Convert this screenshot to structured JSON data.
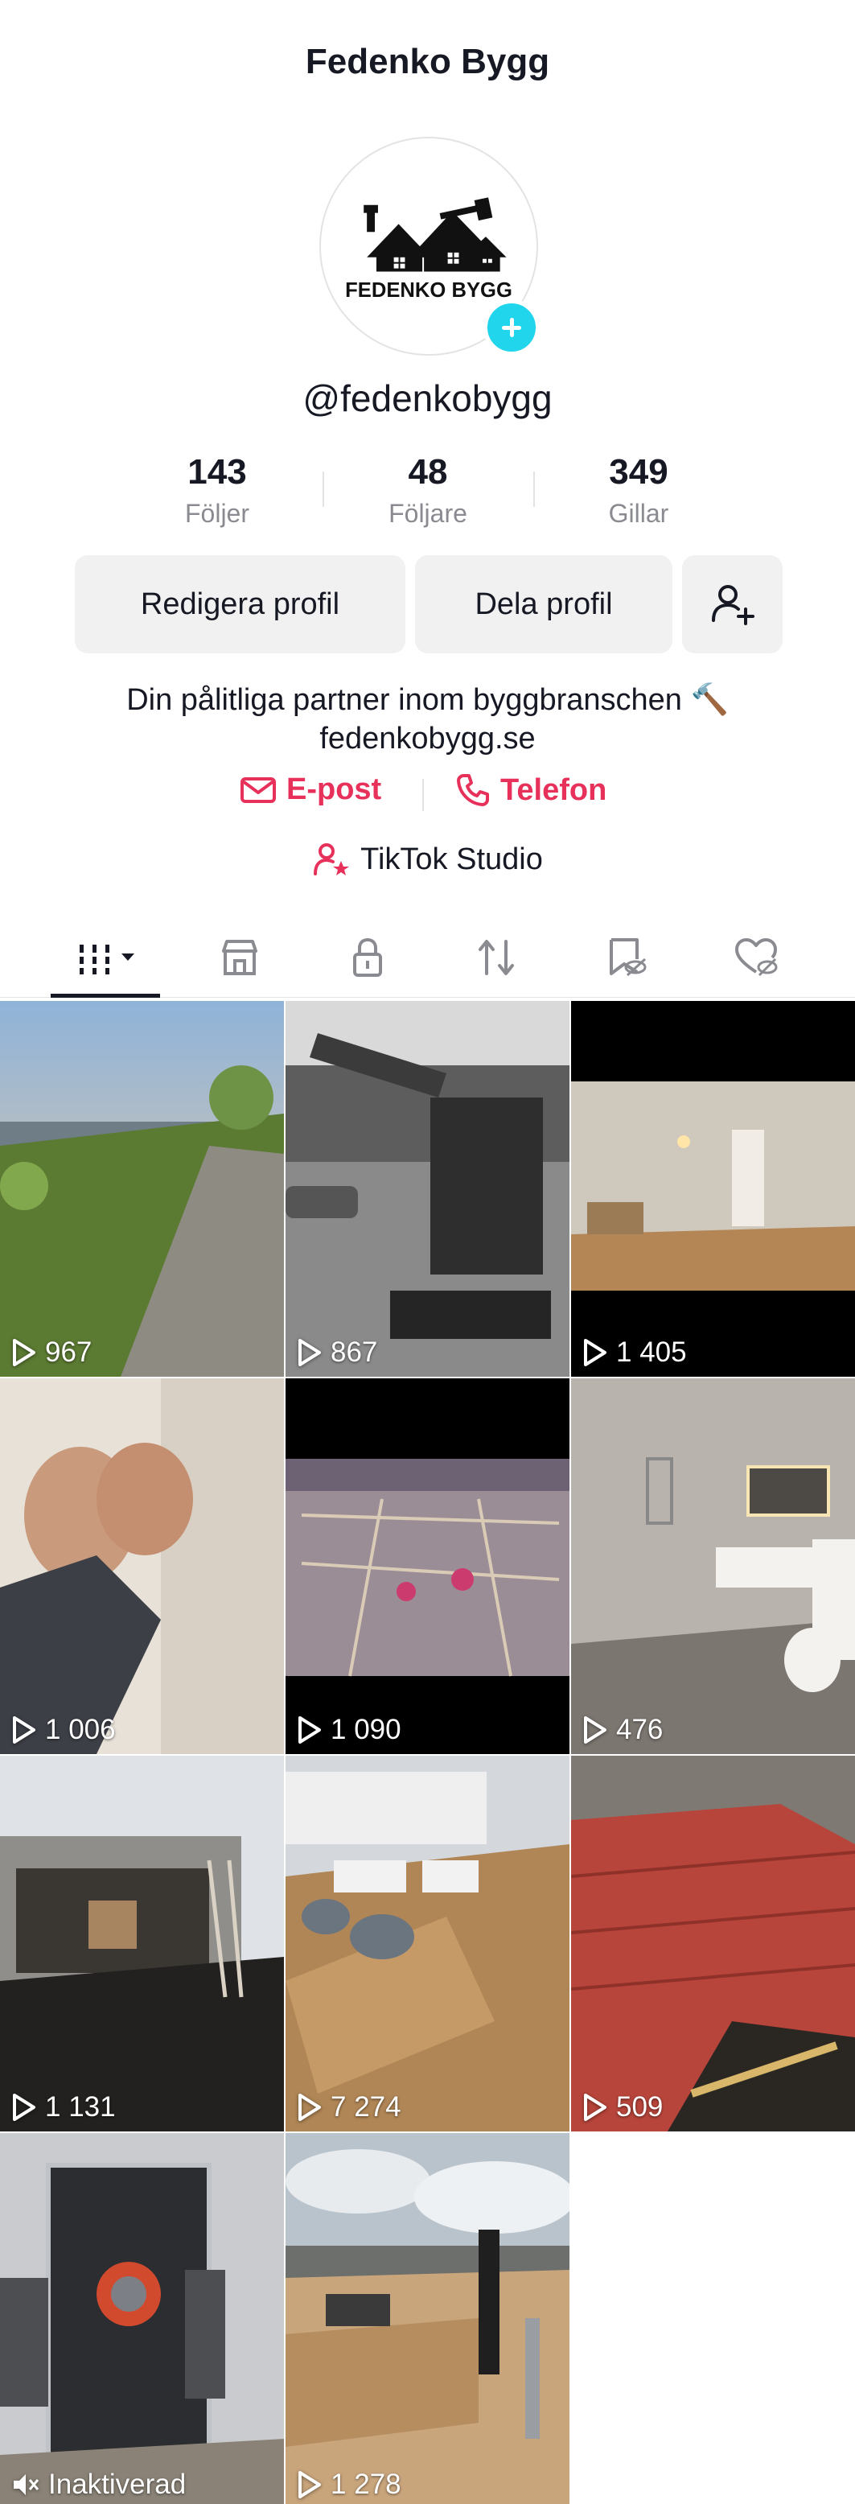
{
  "header": {
    "title": "Fedenko Bygg"
  },
  "profile": {
    "logo_text": "FEDENKO BYGG",
    "username": "@fedenkobygg",
    "stats": [
      {
        "value": "143",
        "label": "Följer"
      },
      {
        "value": "48",
        "label": "Följare"
      },
      {
        "value": "349",
        "label": "Gillar"
      }
    ],
    "buttons": {
      "edit": "Redigera profil",
      "share": "Dela profil"
    },
    "bio_line1": "Din pålitliga partner inom byggbranschen 🔨",
    "bio_line2": "fedenkobygg.se",
    "contacts": {
      "email": "E-post",
      "phone": "Telefon"
    },
    "studio": "TikTok Studio"
  },
  "tabs": [
    "videos",
    "shop",
    "private",
    "reposts",
    "favorites",
    "liked"
  ],
  "videos": [
    {
      "views": "967"
    },
    {
      "views": "867"
    },
    {
      "views": "1 405"
    },
    {
      "views": "1 006"
    },
    {
      "views": "1 090"
    },
    {
      "views": "476"
    },
    {
      "views": "1 131"
    },
    {
      "views": "7 274"
    },
    {
      "views": "509"
    },
    {
      "views": "Inaktiverad"
    },
    {
      "views": "1 278"
    }
  ],
  "colors": {
    "accent": "#e7315a",
    "avatar_add": "#20d5ec",
    "text": "#161823",
    "muted": "#8a8b91"
  }
}
